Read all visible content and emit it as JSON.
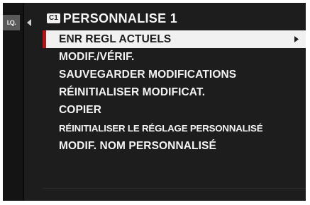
{
  "side_tab_label": "I.Q.",
  "header": {
    "badge": "C1",
    "title": "PERSONNALISE 1"
  },
  "menu": {
    "items": [
      {
        "label": "ENR REGL ACTUELS",
        "selected": true
      },
      {
        "label": "MODIF./VÉRIF."
      },
      {
        "label": "SAUVEGARDER MODIFICATIONS"
      },
      {
        "label": "RÉINITIALISER MODIFICAT."
      },
      {
        "label": "COPIER"
      },
      {
        "label": "RÉINITIALISER LE RÉGLAGE PERSONNALISÉ"
      },
      {
        "label": "MODIF. NOM PERSONNALISÉ"
      }
    ]
  },
  "colors": {
    "selection_marker": "#b01818",
    "highlight": "#f1f1f1",
    "background": "#1d1d1d"
  }
}
